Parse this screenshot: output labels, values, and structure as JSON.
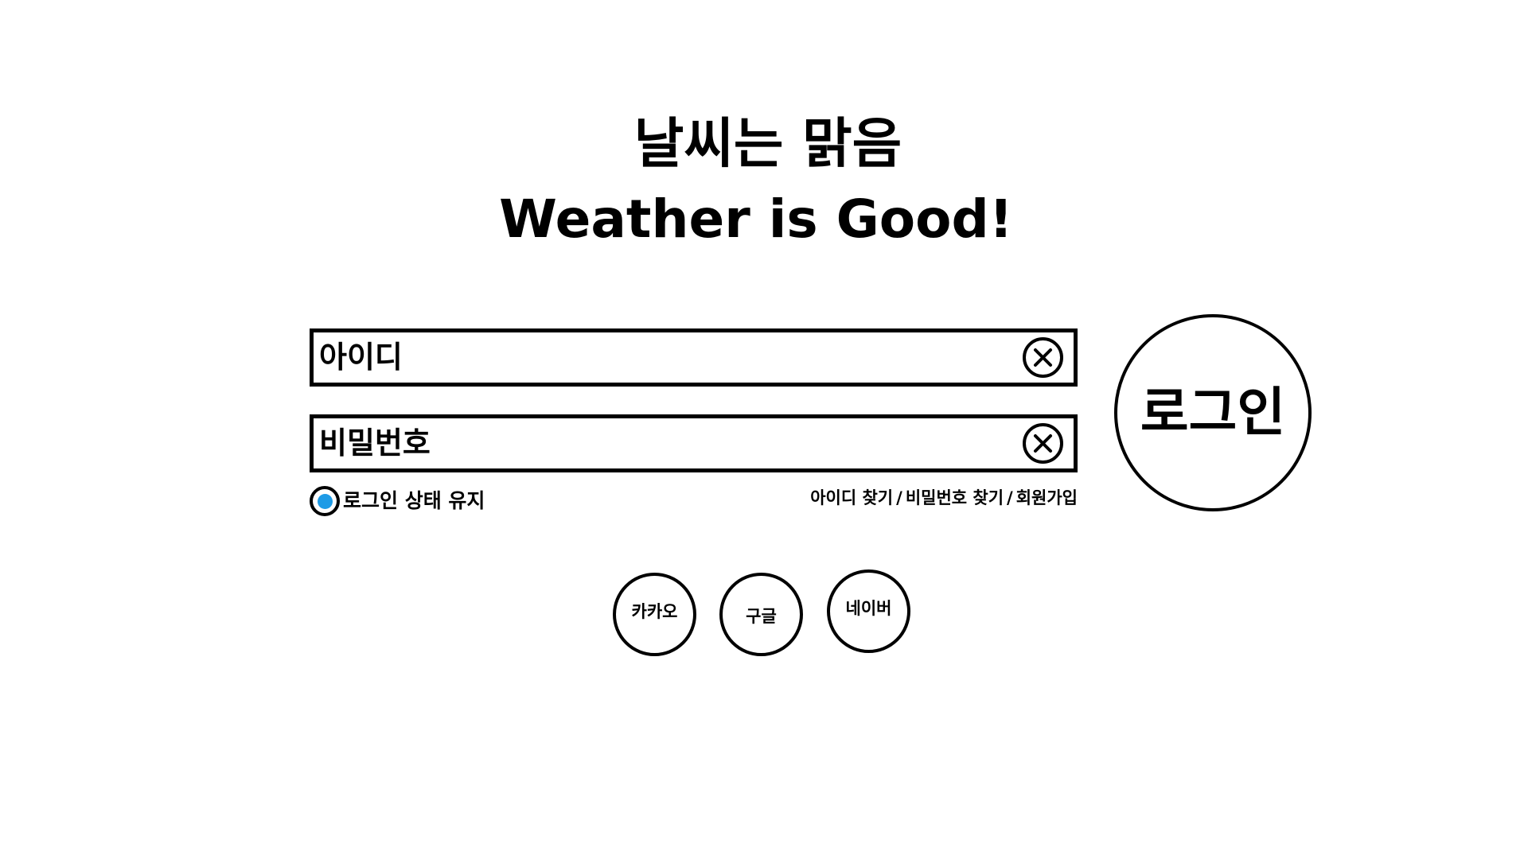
{
  "header": {
    "title_ko": "날씨는 맑음",
    "title_en": "Weather is Good!"
  },
  "login_form": {
    "id_field": {
      "value": "아이디",
      "clear_icon": "close-circle-icon"
    },
    "password_field": {
      "value": "비밀번호",
      "clear_icon": "close-circle-icon"
    },
    "login_button_label": "로그인",
    "keep_login": {
      "label": "로그인 상태 유지",
      "selected": true,
      "indicator_color": "#1e9be6"
    },
    "links": {
      "find_id": "아이디 찾기",
      "separator": "/",
      "find_password": "비밀번호 찾기",
      "signup": "회원가입"
    }
  },
  "social_login": {
    "kakao": "카카오",
    "google": "구글",
    "naver": "네이버"
  },
  "colors": {
    "background": "#ffffff",
    "border": "#000000",
    "radio_selected": "#1e9be6"
  }
}
